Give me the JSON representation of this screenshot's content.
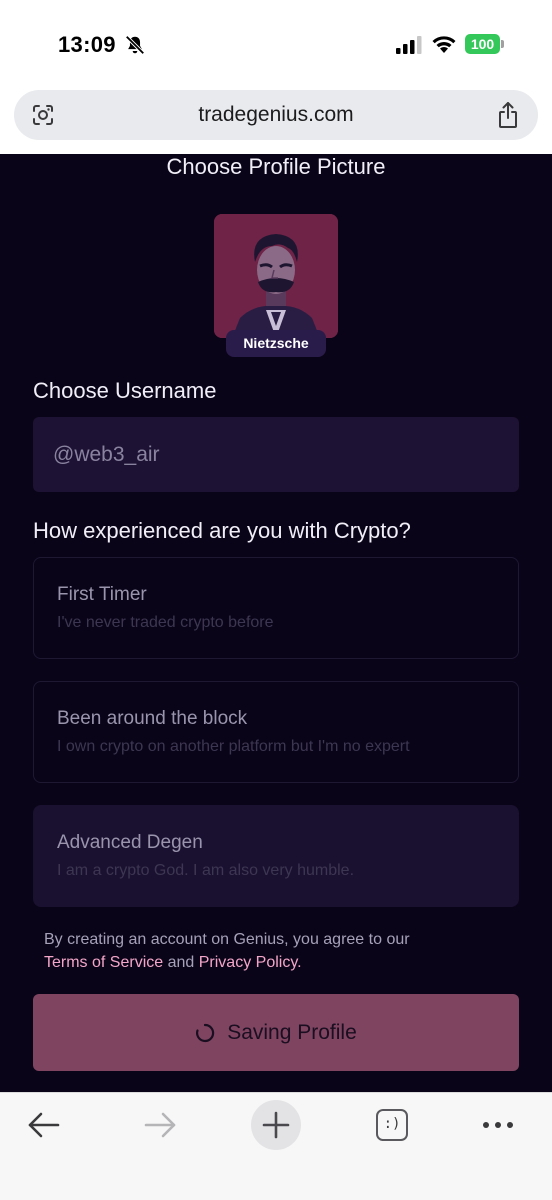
{
  "status_bar": {
    "time": "13:09",
    "battery": "100",
    "icons": [
      "bell-slash-icon",
      "signal-icon",
      "wifi-icon",
      "battery-icon"
    ]
  },
  "browser": {
    "url": "tradegenius.com",
    "icons": [
      "lens-icon",
      "share-icon"
    ]
  },
  "profile": {
    "title": "Choose Profile Picture",
    "avatar_name": "Nietzsche",
    "username_label": "Choose Username",
    "username_value": "@web3_air",
    "experience_label": "How experienced are you with Crypto?",
    "options": [
      {
        "title": "First Timer",
        "subtitle": "I've never traded crypto before"
      },
      {
        "title": "Been around the block",
        "subtitle": "I own crypto on another platform but I'm no expert"
      },
      {
        "title": "Advanced Degen",
        "subtitle": "I am a crypto God. I am also very humble."
      }
    ],
    "selected_option": "Advanced Degen",
    "terms_prefix": "By creating an account on Genius, you agree to our",
    "terms_link": "Terms of Service",
    "terms_and": "and",
    "privacy_link": "Privacy Policy.",
    "save_label": "Saving Profile"
  },
  "toolbar": {
    "tabs_label": ":)",
    "icons": [
      "back-arrow-icon",
      "forward-arrow-icon",
      "plus-icon",
      "tabs-icon",
      "more-icon"
    ]
  },
  "colors": {
    "background": "#0a0418",
    "accent_pink": "#f3a6c9",
    "button": "#7e4460",
    "battery_green": "#34c759"
  }
}
